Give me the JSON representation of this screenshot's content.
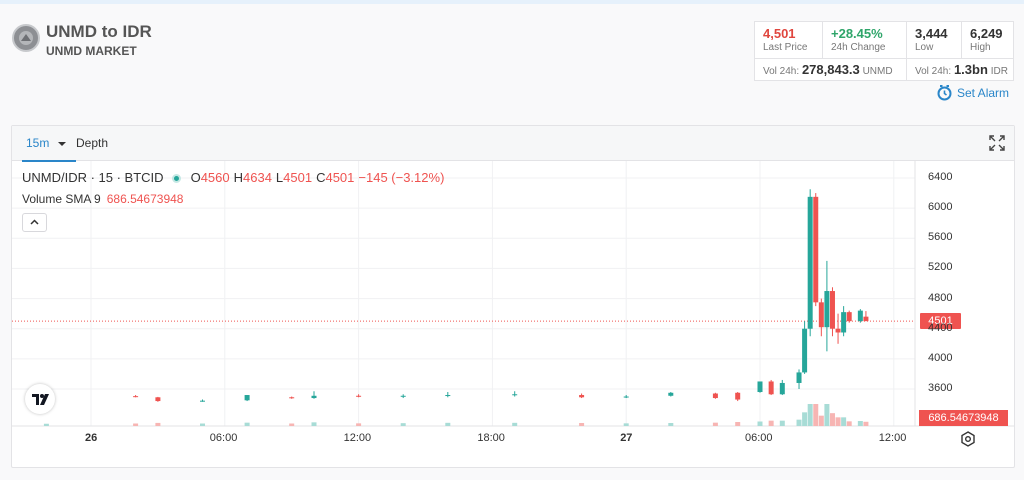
{
  "header": {
    "title": "UNMD to IDR",
    "subtitle": "UNMD MARKET",
    "logo_icon": "unmd-coin-logo"
  },
  "stats": {
    "last_price": {
      "value": "4,501",
      "label": "Last Price",
      "color": "#e0463e"
    },
    "change_24h": {
      "value": "+28.45%",
      "label": "24h Change",
      "color": "#2fa56a"
    },
    "low": {
      "value": "3,444",
      "label": "Low"
    },
    "high": {
      "value": "6,249",
      "label": "High"
    },
    "vol_base": {
      "label": "Vol 24h:",
      "value": "278,843.3",
      "unit": "UNMD"
    },
    "vol_quote": {
      "label": "Vol 24h:",
      "value": "1.3bn",
      "unit": "IDR"
    }
  },
  "alarm": {
    "label": "Set Alarm",
    "icon": "alarm-clock-icon"
  },
  "tabs": {
    "interval": "15m",
    "depth": "Depth"
  },
  "legend": {
    "symbol": "UNMD/IDR · 15 · BTCID",
    "o_key": "O",
    "o": "4560",
    "h_key": "H",
    "h": "4634",
    "l_key": "L",
    "l": "4501",
    "c_key": "C",
    "c": "4501",
    "change": "−145 (−3.12%)",
    "sma_label": "Volume SMA 9",
    "sma_value": "686.54673948"
  },
  "badges": {
    "price": "4501",
    "volume": "686.54673948"
  },
  "axes": {
    "y_ticks": [
      "6400",
      "6000",
      "5600",
      "5200",
      "4800",
      "4400",
      "4000",
      "3600"
    ],
    "x_ticks": [
      "26",
      "06:00",
      "12:00",
      "18:00",
      "27",
      "06:00",
      "12:00"
    ]
  },
  "chart_data": {
    "type": "candlestick",
    "symbol": "UNMD/IDR",
    "interval": "15",
    "ylim": [
      3400,
      6500
    ],
    "y_ticks": [
      3600,
      4000,
      4400,
      4800,
      5200,
      5600,
      6000,
      6400
    ],
    "x_ticks": [
      "26",
      "06:00",
      "12:00",
      "18:00",
      "27",
      "06:00",
      "12:00"
    ],
    "last_price": 4501,
    "volume_sma_9": 686.54673948,
    "colors": {
      "up": "#26a69a",
      "down": "#ef5350"
    },
    "candles": [
      {
        "t": "25 22:00",
        "o": 3500,
        "h": 3510,
        "l": 3495,
        "c": 3505
      },
      {
        "t": "26 02:00",
        "o": 3505,
        "h": 3520,
        "l": 3490,
        "c": 3495
      },
      {
        "t": "26 03:00",
        "o": 3490,
        "h": 3495,
        "l": 3430,
        "c": 3440
      },
      {
        "t": "26 05:00",
        "o": 3440,
        "h": 3460,
        "l": 3430,
        "c": 3445
      },
      {
        "t": "26 07:00",
        "o": 3450,
        "h": 3520,
        "l": 3440,
        "c": 3520
      },
      {
        "t": "26 09:00",
        "o": 3490,
        "h": 3500,
        "l": 3470,
        "c": 3480
      },
      {
        "t": "26 10:00",
        "o": 3480,
        "h": 3570,
        "l": 3470,
        "c": 3510
      },
      {
        "t": "26 12:00",
        "o": 3510,
        "h": 3530,
        "l": 3490,
        "c": 3500
      },
      {
        "t": "26 14:00",
        "o": 3500,
        "h": 3530,
        "l": 3480,
        "c": 3510
      },
      {
        "t": "26 16:00",
        "o": 3510,
        "h": 3560,
        "l": 3490,
        "c": 3520
      },
      {
        "t": "26 19:00",
        "o": 3520,
        "h": 3570,
        "l": 3500,
        "c": 3530
      },
      {
        "t": "26 22:00",
        "o": 3520,
        "h": 3540,
        "l": 3480,
        "c": 3490
      },
      {
        "t": "27 00:00",
        "o": 3490,
        "h": 3520,
        "l": 3480,
        "c": 3500
      },
      {
        "t": "27 02:00",
        "o": 3510,
        "h": 3560,
        "l": 3500,
        "c": 3550
      },
      {
        "t": "27 04:00",
        "o": 3540,
        "h": 3550,
        "l": 3470,
        "c": 3480
      },
      {
        "t": "27 05:00",
        "o": 3550,
        "h": 3560,
        "l": 3440,
        "c": 3460
      },
      {
        "t": "27 06:00",
        "o": 3560,
        "h": 3700,
        "l": 3550,
        "c": 3700
      },
      {
        "t": "27 06:30",
        "o": 3700,
        "h": 3720,
        "l": 3520,
        "c": 3530
      },
      {
        "t": "27 07:00",
        "o": 3530,
        "h": 3720,
        "l": 3520,
        "c": 3680
      },
      {
        "t": "27 07:45",
        "o": 3680,
        "h": 3860,
        "l": 3600,
        "c": 3820
      },
      {
        "t": "27 08:00",
        "o": 3820,
        "h": 4500,
        "l": 3800,
        "c": 4400
      },
      {
        "t": "27 08:15",
        "o": 4400,
        "h": 6250,
        "l": 4300,
        "c": 6150
      },
      {
        "t": "27 08:30",
        "o": 6150,
        "h": 6200,
        "l": 4700,
        "c": 4750
      },
      {
        "t": "27 08:45",
        "o": 4750,
        "h": 4800,
        "l": 4300,
        "c": 4420
      },
      {
        "t": "27 09:00",
        "o": 4420,
        "h": 5300,
        "l": 4100,
        "c": 4900
      },
      {
        "t": "27 09:15",
        "o": 4900,
        "h": 4950,
        "l": 4300,
        "c": 4400
      },
      {
        "t": "27 09:30",
        "o": 4400,
        "h": 4600,
        "l": 4200,
        "c": 4350
      },
      {
        "t": "27 09:45",
        "o": 4350,
        "h": 4700,
        "l": 4300,
        "c": 4620
      },
      {
        "t": "27 10:00",
        "o": 4620,
        "h": 4640,
        "l": 4480,
        "c": 4500
      },
      {
        "t": "27 10:30",
        "o": 4500,
        "h": 4660,
        "l": 4480,
        "c": 4640
      },
      {
        "t": "27 10:45",
        "o": 4560,
        "h": 4634,
        "l": 4501,
        "c": 4501
      }
    ]
  }
}
